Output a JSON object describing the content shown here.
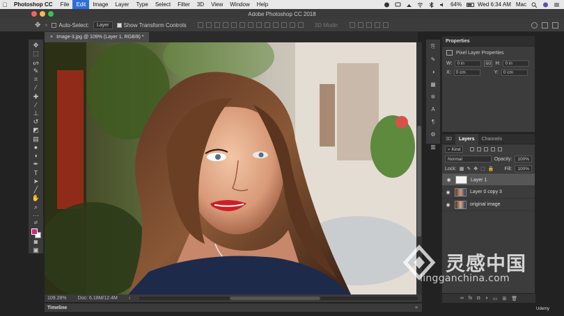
{
  "menubar": {
    "app": "Photoshop CC",
    "items": [
      "File",
      "Edit",
      "Image",
      "Layer",
      "Type",
      "Select",
      "Filter",
      "3D",
      "View",
      "Window",
      "Help"
    ],
    "active": "Edit",
    "battery": "64%",
    "clock": "Wed 6:34 AM",
    "user": "Mac"
  },
  "window": {
    "title": "Adobe Photoshop CC 2018"
  },
  "options": {
    "auto_select": "Auto-Select:",
    "auto_select_target": "Layer",
    "show_transform": "Show Transform Controls",
    "mode_3d": "3D Mode:"
  },
  "document": {
    "tab_title": "Image-3.jpg @ 109% (Layer 1, RGB/8) *",
    "zoom": "109.28%",
    "doc_size": "Doc: 6.18M/12.4M"
  },
  "timeline": {
    "label": "Timeline"
  },
  "properties": {
    "title": "Properties",
    "subtitle": "Pixel Layer Properties",
    "w_label": "W:",
    "w_value": "0 in",
    "go_label": "GO",
    "h_label": "H:",
    "h_value": "0 in",
    "x_label": "X:",
    "x_value": "0 cm",
    "y_label": "Y:",
    "y_value": "0 cm"
  },
  "layers_panel": {
    "tabs": [
      "3D",
      "Layers",
      "Channels"
    ],
    "active_tab": "Layers",
    "filter_kind": "Kind",
    "blend_mode": "Normal",
    "opacity_label": "Opacity:",
    "opacity_value": "100%",
    "lock_label": "Lock:",
    "fill_label": "Fill:",
    "fill_value": "100%",
    "layers": [
      {
        "name": "Layer 1",
        "selected": true
      },
      {
        "name": "Layer 0 copy 3",
        "selected": false
      },
      {
        "name": "original image",
        "selected": false
      }
    ]
  },
  "watermark": {
    "cn": "灵感中国",
    "url": "lingganchina.com"
  },
  "udemy": "Udemy",
  "colors": {
    "foreground": "#c8287a",
    "background": "#ffffff",
    "accent": "#2d6fd6"
  }
}
